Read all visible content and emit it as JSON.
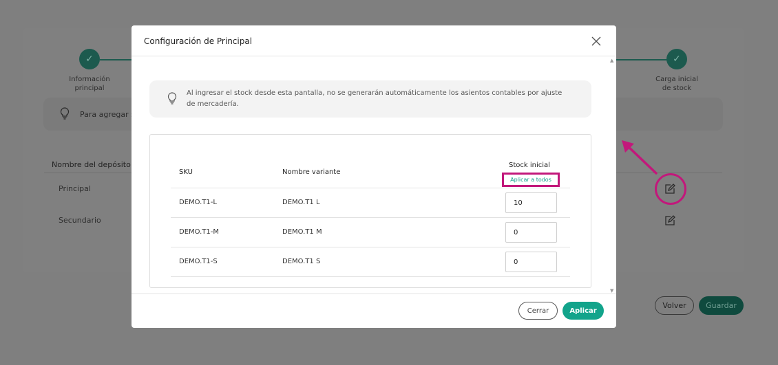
{
  "background": {
    "steps": [
      {
        "label_line1": "Información",
        "label_line2": "principal"
      },
      {
        "label_line1": "Carga inicial",
        "label_line2": "de stock"
      }
    ],
    "info_text": "Para agregar s",
    "table_header": "Nombre del depósito",
    "rows": [
      "Principal",
      "Secundario"
    ],
    "buttons": {
      "volver": "Volver",
      "guardar": "Guardar"
    }
  },
  "modal": {
    "title": "Configuración de Principal",
    "info_text": "Al ingresar el stock desde esta pantalla, no se generarán automáticamente los asientos contables por ajuste de mercadería.",
    "columns": {
      "sku": "SKU",
      "variant": "Nombre variante",
      "stock": "Stock inicial"
    },
    "apply_all": "Aplicar a todos",
    "rows": [
      {
        "sku": "DEMO.T1-L",
        "variant": "DEMO.T1 L",
        "stock": "10"
      },
      {
        "sku": "DEMO.T1-M",
        "variant": "DEMO.T1 M",
        "stock": "0"
      },
      {
        "sku": "DEMO.T1-S",
        "variant": "DEMO.T1 S",
        "stock": "0"
      }
    ],
    "buttons": {
      "close": "Cerrar",
      "apply": "Aplicar"
    }
  },
  "colors": {
    "accent": "#12a48b",
    "highlight": "#c2187b",
    "overlay": "#7f7f7f"
  },
  "icons": [
    "check-icon",
    "lightbulb-icon",
    "edit-icon",
    "close-icon",
    "arrow-icon"
  ]
}
